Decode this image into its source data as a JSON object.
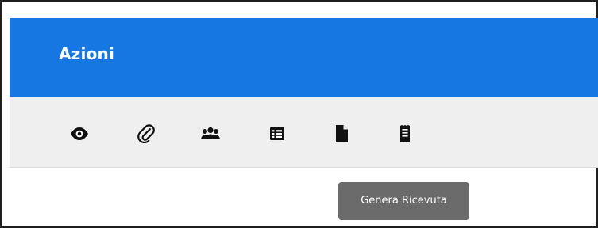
{
  "header": {
    "title": "Azioni",
    "accent_color": "#1677e2"
  },
  "toolbar": {
    "background_color": "#efefef",
    "actions": [
      {
        "id": "view",
        "icon": "eye-icon"
      },
      {
        "id": "attachments",
        "icon": "paperclip-icon"
      },
      {
        "id": "users",
        "icon": "users-icon"
      },
      {
        "id": "list",
        "icon": "list-icon"
      },
      {
        "id": "document",
        "icon": "file-icon"
      },
      {
        "id": "receipt",
        "icon": "receipt-icon"
      }
    ]
  },
  "tooltip": {
    "text": "Genera Ricevuta",
    "background_color": "#6b6b6b"
  }
}
